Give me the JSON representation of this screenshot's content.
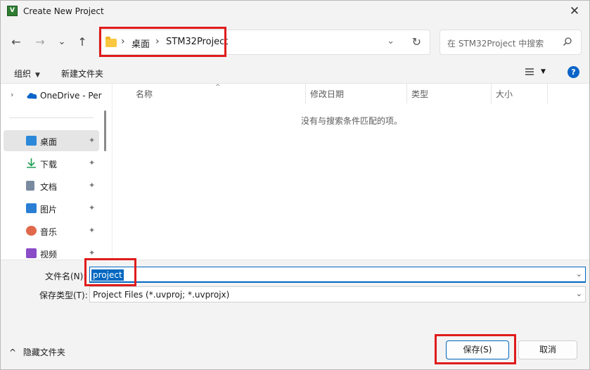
{
  "window": {
    "title": "Create New Project",
    "close_label": "✕"
  },
  "nav": {
    "back": "←",
    "forward": "→",
    "history": "⌄",
    "up": "↑",
    "breadcrumb": [
      "桌面",
      "STM32Project"
    ],
    "sep": "›",
    "dropdown": "⌄",
    "refresh": "↻",
    "search_placeholder": "在 STM32Project 中搜索"
  },
  "toolbar": {
    "organize": "组织",
    "new_folder": "新建文件夹",
    "help": "?"
  },
  "sidebar": {
    "onedrive": "OneDrive - Per",
    "items": [
      {
        "label": "桌面",
        "icon": "desktop-icon",
        "color": "#2b88d8"
      },
      {
        "label": "下载",
        "icon": "download-icon",
        "color": "#1f9d55"
      },
      {
        "label": "文档",
        "icon": "document-icon",
        "color": "#7a8aa0"
      },
      {
        "label": "图片",
        "icon": "picture-icon",
        "color": "#2a7fd4"
      },
      {
        "label": "音乐",
        "icon": "music-icon",
        "color": "#e0684b"
      },
      {
        "label": "视频",
        "icon": "video-icon",
        "color": "#8a4cc7"
      }
    ]
  },
  "filelist": {
    "columns": [
      "名称",
      "修改日期",
      "类型",
      "大小"
    ],
    "empty_text": "没有与搜索条件匹配的项。"
  },
  "bottom": {
    "filename_label": "文件名(N):",
    "filename_value": "project",
    "filetype_label": "保存类型(T):",
    "filetype_value": "Project Files (*.uvproj; *.uvprojx)",
    "hide_folders": "隐藏文件夹",
    "save": "保存(S)",
    "cancel": "取消"
  },
  "colors": {
    "accent": "#0067c0",
    "highlight_box": "#e01b1b"
  }
}
